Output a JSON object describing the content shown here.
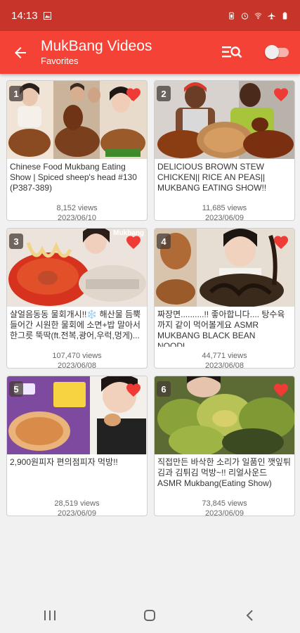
{
  "status_bar": {
    "time": "14:13"
  },
  "app_bar": {
    "title": "MukBang Videos",
    "subtitle": "Favorites"
  },
  "colors": {
    "primary": "#f44336",
    "status_bar": "#c7342a",
    "heart": "#ef3b35"
  },
  "videos": [
    {
      "index": "1",
      "title": "Chinese Food Mukbang Eating Show | Spiced sheep's head #130 (P387-389)",
      "views": "8,152 views",
      "date": "2023/06/10",
      "favorite": true
    },
    {
      "index": "2",
      "title": "DELICIOUS BROWN STEW CHICKEN|| RICE AN PEAS|| MUKBANG EATING SHOW!!",
      "views": "11,685 views",
      "date": "2023/06/09",
      "favorite": true
    },
    {
      "index": "3",
      "title": "살얼음동동 물회개시!!❄️ 해산물 듬뿍 들어간 시원한 물회에 소면+밥 말아서 한그릇 뚝딱(ft.전복,광어,우럭,멍게)...",
      "views": "107,470 views",
      "date": "2023/06/08",
      "favorite": true,
      "thumb_label": "Mukbang"
    },
    {
      "index": "4",
      "title": "짜장면..........!! 좋아합니다.... 탕수육까지 같이 먹어볼게요 ASMR MUKBANG BLACK BEAN NOODL...",
      "views": "44,771 views",
      "date": "2023/06/08",
      "favorite": true
    },
    {
      "index": "5",
      "title": "2,900원피자 편의점피자 먹방!!",
      "views": "28,519 views",
      "date": "2023/06/09",
      "favorite": true,
      "thumb_label": "피자 득템"
    },
    {
      "index": "6",
      "title": "직접만든 바삭한 소리가 일품인 깻잎튀김과 김튀김 먹방~!! 리얼사운드 ASMR Mukbang(Eating Show)",
      "views": "73,845 views",
      "date": "2023/06/09",
      "favorite": true
    }
  ]
}
